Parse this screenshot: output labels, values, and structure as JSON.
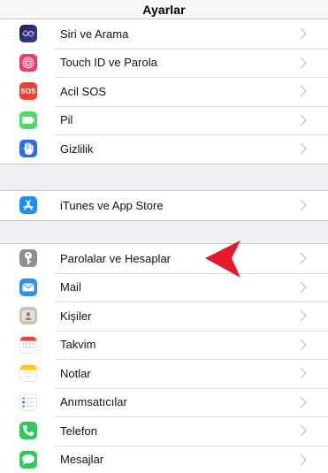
{
  "nav": {
    "title": "Ayarlar"
  },
  "groups": [
    {
      "rows": [
        {
          "label": "Siri ve Arama",
          "icon": "siri-icon",
          "color": "#1f3a93"
        },
        {
          "label": "Touch ID ve Parola",
          "icon": "fingerprint-icon",
          "color": "#f0386b"
        },
        {
          "label": "Acil SOS",
          "icon": "sos-icon",
          "color": "#e9402f",
          "icon_text": "SOS"
        },
        {
          "label": "Pil",
          "icon": "battery-icon",
          "color": "#4cd964"
        },
        {
          "label": "Gizlilik",
          "icon": "hand-icon",
          "color": "#2b6ee6"
        }
      ]
    },
    {
      "rows": [
        {
          "label": "iTunes ve App Store",
          "icon": "app-store-icon",
          "color": "#1c8ef5"
        }
      ]
    },
    {
      "rows": [
        {
          "label": "Parolalar ve Hesaplar",
          "icon": "key-icon",
          "color": "#8e8e93"
        },
        {
          "label": "Mail",
          "icon": "mail-icon",
          "color": "#2f8df5"
        },
        {
          "label": "Kişiler",
          "icon": "contacts-icon",
          "color": "#b9b4a9"
        },
        {
          "label": "Takvim",
          "icon": "calendar-icon",
          "color": "#ffffff"
        },
        {
          "label": "Notlar",
          "icon": "notes-icon",
          "color": "#ffcc00"
        },
        {
          "label": "Anımsatıcılar",
          "icon": "reminders-icon",
          "color": "#ffffff"
        },
        {
          "label": "Telefon",
          "icon": "phone-icon",
          "color": "#34c759"
        },
        {
          "label": "Mesajlar",
          "icon": "messages-icon",
          "color": "#34c759"
        }
      ]
    }
  ],
  "annotation": {
    "icon": "red-pointer-arrow-icon",
    "color": "#e4192a"
  }
}
